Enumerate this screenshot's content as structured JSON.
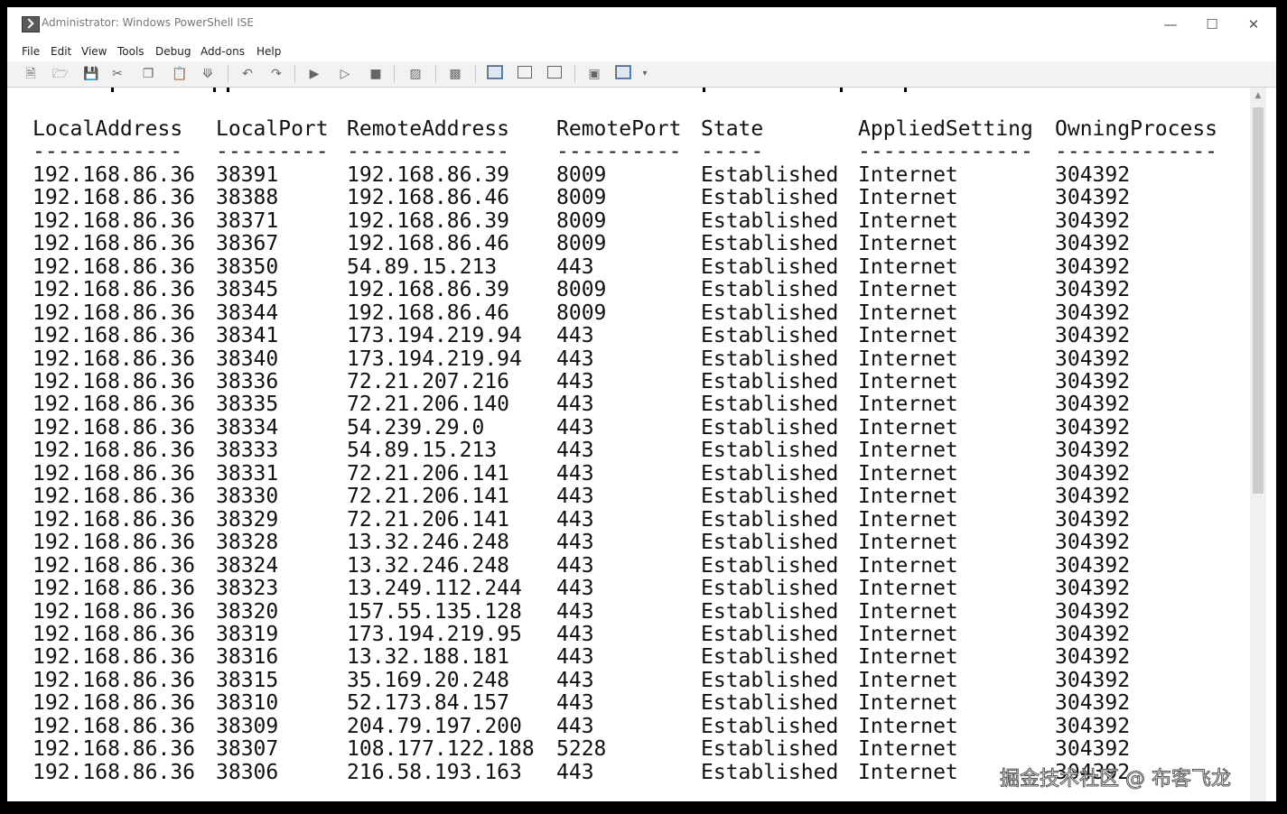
{
  "window": {
    "title": "Administrator: Windows PowerShell ISE",
    "controls": {
      "minimize": "—",
      "maximize": "☐",
      "close": "✕"
    }
  },
  "menu": [
    "File",
    "Edit",
    "View",
    "Tools",
    "Debug",
    "Add-ons",
    "Help"
  ],
  "toolbar": {
    "icons": [
      "new-file-icon",
      "open-folder-icon",
      "save-icon",
      "cut-icon",
      "copy-icon",
      "paste-icon",
      "clear-console-icon",
      "undo-icon",
      "redo-icon",
      "run-icon",
      "run-selection-icon",
      "stop-icon",
      "remote-powershell-icon",
      "powershell-console-icon",
      "show-script-pane-top-icon",
      "show-script-pane-right-icon",
      "show-script-pane-max-icon",
      "command-pane-icon",
      "command-addon-icon",
      "toolbar-overflow-icon"
    ]
  },
  "output": {
    "headers": [
      "LocalAddress",
      "LocalPort",
      "RemoteAddress",
      "RemotePort",
      "State",
      "AppliedSetting",
      "OwningProcess"
    ],
    "underlines": [
      "------------",
      "---------",
      "-------------",
      "----------",
      "-----",
      "--------------",
      "-------------"
    ],
    "rows": [
      [
        "192.168.86.36",
        "38391",
        "192.168.86.39",
        "8009",
        "Established",
        "Internet",
        "304392"
      ],
      [
        "192.168.86.36",
        "38388",
        "192.168.86.46",
        "8009",
        "Established",
        "Internet",
        "304392"
      ],
      [
        "192.168.86.36",
        "38371",
        "192.168.86.39",
        "8009",
        "Established",
        "Internet",
        "304392"
      ],
      [
        "192.168.86.36",
        "38367",
        "192.168.86.46",
        "8009",
        "Established",
        "Internet",
        "304392"
      ],
      [
        "192.168.86.36",
        "38350",
        "54.89.15.213",
        "443",
        "Established",
        "Internet",
        "304392"
      ],
      [
        "192.168.86.36",
        "38345",
        "192.168.86.39",
        "8009",
        "Established",
        "Internet",
        "304392"
      ],
      [
        "192.168.86.36",
        "38344",
        "192.168.86.46",
        "8009",
        "Established",
        "Internet",
        "304392"
      ],
      [
        "192.168.86.36",
        "38341",
        "173.194.219.94",
        "443",
        "Established",
        "Internet",
        "304392"
      ],
      [
        "192.168.86.36",
        "38340",
        "173.194.219.94",
        "443",
        "Established",
        "Internet",
        "304392"
      ],
      [
        "192.168.86.36",
        "38336",
        "72.21.207.216",
        "443",
        "Established",
        "Internet",
        "304392"
      ],
      [
        "192.168.86.36",
        "38335",
        "72.21.206.140",
        "443",
        "Established",
        "Internet",
        "304392"
      ],
      [
        "192.168.86.36",
        "38334",
        "54.239.29.0",
        "443",
        "Established",
        "Internet",
        "304392"
      ],
      [
        "192.168.86.36",
        "38333",
        "54.89.15.213",
        "443",
        "Established",
        "Internet",
        "304392"
      ],
      [
        "192.168.86.36",
        "38331",
        "72.21.206.141",
        "443",
        "Established",
        "Internet",
        "304392"
      ],
      [
        "192.168.86.36",
        "38330",
        "72.21.206.141",
        "443",
        "Established",
        "Internet",
        "304392"
      ],
      [
        "192.168.86.36",
        "38329",
        "72.21.206.141",
        "443",
        "Established",
        "Internet",
        "304392"
      ],
      [
        "192.168.86.36",
        "38328",
        "13.32.246.248",
        "443",
        "Established",
        "Internet",
        "304392"
      ],
      [
        "192.168.86.36",
        "38324",
        "13.32.246.248",
        "443",
        "Established",
        "Internet",
        "304392"
      ],
      [
        "192.168.86.36",
        "38323",
        "13.249.112.244",
        "443",
        "Established",
        "Internet",
        "304392"
      ],
      [
        "192.168.86.36",
        "38320",
        "157.55.135.128",
        "443",
        "Established",
        "Internet",
        "304392"
      ],
      [
        "192.168.86.36",
        "38319",
        "173.194.219.95",
        "443",
        "Established",
        "Internet",
        "304392"
      ],
      [
        "192.168.86.36",
        "38316",
        "13.32.188.181",
        "443",
        "Established",
        "Internet",
        "304392"
      ],
      [
        "192.168.86.36",
        "38315",
        "35.169.20.248",
        "443",
        "Established",
        "Internet",
        "304392"
      ],
      [
        "192.168.86.36",
        "38310",
        "52.173.84.157",
        "443",
        "Established",
        "Internet",
        "304392"
      ],
      [
        "192.168.86.36",
        "38309",
        "204.79.197.200",
        "443",
        "Established",
        "Internet",
        "304392"
      ],
      [
        "192.168.86.36",
        "38307",
        "108.177.122.188",
        "5228",
        "Established",
        "Internet",
        "304392"
      ],
      [
        "192.168.86.36",
        "38306",
        "216.58.193.163",
        "443",
        "Established",
        "Internet",
        "304392"
      ]
    ]
  },
  "watermark": "掘金技术社区 @ 布客飞龙"
}
